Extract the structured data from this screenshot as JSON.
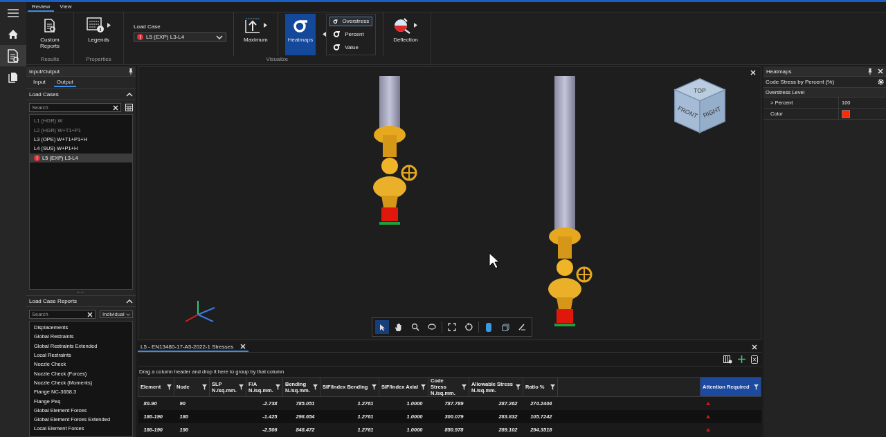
{
  "rail": [
    {
      "selected": false
    },
    {
      "selected": true
    },
    {
      "selected": false
    }
  ],
  "ribbon": {
    "tabs": [
      {
        "label": "Review",
        "selected": true
      },
      {
        "label": "View",
        "selected": false
      }
    ],
    "groups": [
      {
        "label": "Results",
        "items": [
          {
            "kind": "button",
            "label": "Custom Reports",
            "menu": false,
            "selected": false
          }
        ]
      },
      {
        "label": "Properties",
        "items": [
          {
            "kind": "button",
            "label": "Legends",
            "menu": true,
            "selected": false
          }
        ]
      },
      {
        "label": "Visualize",
        "items": [
          {
            "kind": "dropdown",
            "label": "Load Case",
            "value": "L5 (EXP) L3-L4",
            "warning": true
          },
          {
            "kind": "button",
            "label": "Maximum",
            "menu": true,
            "selected": false
          },
          {
            "kind": "button",
            "label": "Heatmaps",
            "menu": false,
            "selected": true
          },
          {
            "kind": "options",
            "options": [
              {
                "label": "Overstress",
                "selected": true
              },
              {
                "label": "Percent",
                "selected": false
              },
              {
                "label": "Value",
                "selected": false
              }
            ]
          },
          {
            "kind": "button",
            "label": "Deflection",
            "menu": true,
            "selected": false
          }
        ]
      }
    ]
  },
  "left_panel": {
    "title": "Input/Output",
    "tabs": [
      {
        "label": "Input",
        "selected": false
      },
      {
        "label": "Output",
        "selected": true
      }
    ],
    "load_cases": {
      "title": "Load Cases",
      "search_placeholder": "Search",
      "items": [
        {
          "label": "L1 (HGR) W",
          "disabled": true,
          "selected": false,
          "warning": false
        },
        {
          "label": "L2 (HGR) W+T1+P1",
          "disabled": true,
          "selected": false,
          "warning": false
        },
        {
          "label": "L3 (OPE) W+T1+P1+H",
          "disabled": false,
          "selected": false,
          "warning": false
        },
        {
          "label": "L4 (SUS) W+P1+H",
          "disabled": false,
          "selected": false,
          "warning": false
        },
        {
          "label": "L5 (EXP) L3-L4",
          "disabled": false,
          "selected": true,
          "warning": true
        }
      ]
    },
    "reports": {
      "title": "Load Case Reports",
      "search_placeholder": "Search",
      "filter": "Individual",
      "items": [
        "Displacements",
        "Global Restraints",
        "Global Restraints Extended",
        "Local Restraints",
        "Nozzle Check",
        "Nozzle Check (Forces)",
        "Nozzle Check (Moments)",
        "Flange NC-3658.3",
        "Flange Peq",
        "Global Element Forces",
        "Global Element Forces Extended",
        "Local Element Forces"
      ]
    }
  },
  "viewport": {
    "view_cube": {
      "top": "TOP",
      "front": "FRONT",
      "right": "RIGHT"
    }
  },
  "results_panel": {
    "tab": "L5 - EN13480-17-A5-2022-1 Stresses",
    "group_hint": "Drag a column header and drop it here to group by that column",
    "columns": [
      {
        "label": "Element",
        "selected": false
      },
      {
        "label": "Node",
        "selected": false
      },
      {
        "label": "SLP",
        "unit": "N./sq.mm.",
        "selected": false
      },
      {
        "label": "F/A",
        "unit": "N./sq.mm.",
        "selected": false
      },
      {
        "label": "Bending",
        "unit": "N./sq.mm.",
        "selected": false
      },
      {
        "label": "SIF/Index Bending",
        "selected": false
      },
      {
        "label": "SIF/Index Axial",
        "selected": false
      },
      {
        "label": "Code Stress",
        "unit": "N./sq.mm.",
        "selected": false
      },
      {
        "label": "Allowable Stress",
        "unit": "N./sq.mm.",
        "selected": false
      },
      {
        "label": "Ratio %",
        "selected": false
      },
      {
        "label": "Attention Required",
        "selected": true
      }
    ],
    "rows": [
      {
        "cells": [
          "80-90",
          "90",
          null,
          "-2.738",
          "785.051",
          "1.2761",
          "1.0000",
          "787.789",
          "287.262",
          "274.2404"
        ],
        "attention": true
      },
      {
        "cells": [
          "180-190",
          "180",
          null,
          "-1.425",
          "298.654",
          "1.2761",
          "1.0000",
          "300.079",
          "283.832",
          "105.7242"
        ],
        "attention": true
      },
      {
        "cells": [
          "180-190",
          "190",
          null,
          "-2.506",
          "848.472",
          "1.2761",
          "1.0000",
          "850.978",
          "289.102",
          "294.3518"
        ],
        "attention": true
      }
    ]
  },
  "heatmaps_panel": {
    "title": "Heatmaps",
    "subtitle": "Code Stress by Percent (%)",
    "section": "Overstress Level",
    "properties": [
      {
        "kind": "text",
        "label": "> Percent",
        "value": "100"
      },
      {
        "kind": "color",
        "label": "Color",
        "color": "#ff2a00"
      }
    ]
  }
}
